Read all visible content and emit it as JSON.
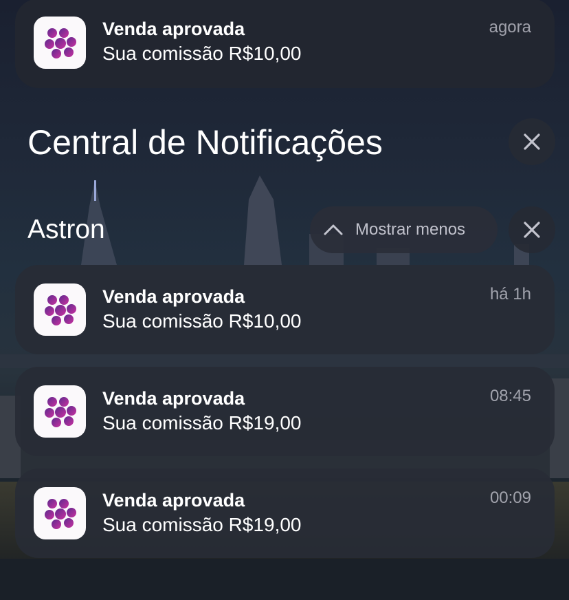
{
  "top_notification": {
    "title": "Venda aprovada",
    "body": "Sua comissão R$10,00",
    "time": "agora"
  },
  "notification_center": {
    "title": "Central de Notificações"
  },
  "group": {
    "app_name": "Astron",
    "show_less_label": "Mostrar menos",
    "notifications": [
      {
        "title": "Venda aprovada",
        "body": "Sua comissão R$10,00",
        "time": "há 1h"
      },
      {
        "title": "Venda aprovada",
        "body": "Sua comissão R$19,00",
        "time": "08:45"
      },
      {
        "title": "Venda aprovada",
        "body": "Sua comissão R$19,00",
        "time": "00:09"
      }
    ]
  },
  "icons": {
    "app_icon": "astron-logo-icon",
    "close": "close-icon",
    "chevron": "chevron-up-icon"
  },
  "colors": {
    "logo_gradient_start": "#5e2a8e",
    "logo_gradient_end": "#c8329f",
    "card_background": "#282c36"
  }
}
